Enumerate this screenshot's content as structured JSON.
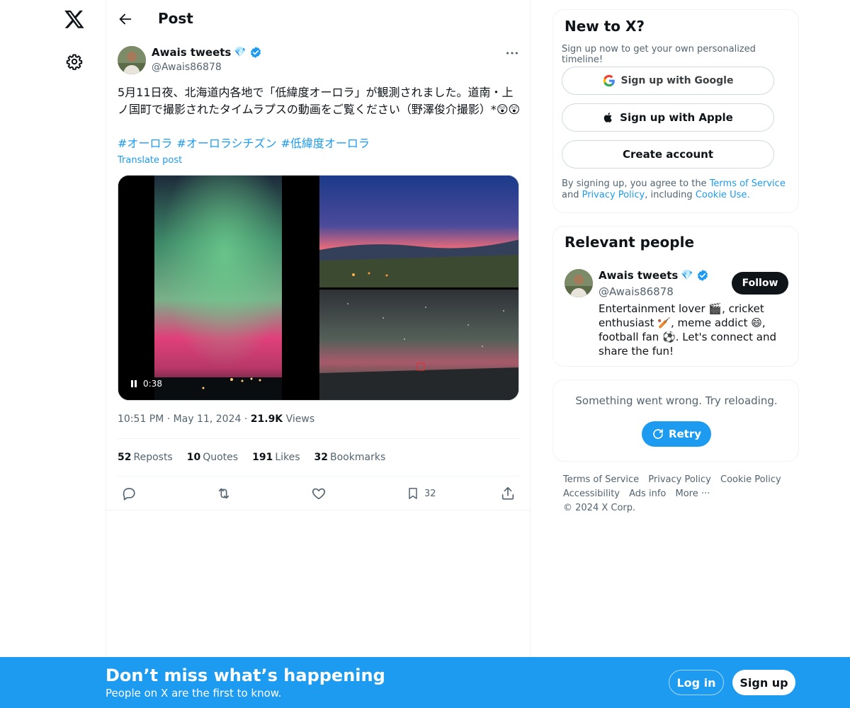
{
  "header": {
    "title": "Post"
  },
  "post": {
    "author_name": "Awais tweets",
    "author_badge": "💎",
    "author_handle": "@Awais86878",
    "text": "5月11日夜、北海道内各地で「低緯度オーロラ」が観測されました。道南・上ノ国町で撮影されたタイムラプスの動画をご覧ください（野澤俊介撮影）*😲😲",
    "hashtags": [
      "#オーロラ",
      "#オーロラシチズン",
      "#低緯度オーロラ"
    ],
    "translate_label": "Translate post",
    "video_time": "0:38",
    "timestamp": "10:51 PM · May 11, 2024 · ",
    "views_count": "21.9K",
    "views_label": " Views",
    "stats": {
      "reposts_count": "52",
      "reposts_label": "Reposts",
      "quotes_count": "10",
      "quotes_label": "Quotes",
      "likes_count": "191",
      "likes_label": "Likes",
      "bookmarks_count": "32",
      "bookmarks_label": "Bookmarks"
    },
    "bookmark_action_count": "32"
  },
  "signup_card": {
    "title": "New to X?",
    "subtitle": "Sign up now to get your own personalized timeline!",
    "google_label": "Sign up with Google",
    "apple_label": "Sign up with Apple",
    "create_label": "Create account",
    "legal_prefix": "By signing up, you agree to the ",
    "terms": "Terms of Service",
    "and": " and ",
    "privacy": "Privacy Policy",
    "including": ", including ",
    "cookie": "Cookie Use."
  },
  "relevant": {
    "title": "Relevant people",
    "name": "Awais tweets",
    "badge": "💎",
    "handle": "@Awais86878",
    "follow_label": "Follow",
    "bio": "Entertainment lover 🎬, cricket enthusiast 🏏, meme addict 😄, football fan ⚽. Let's connect and share the fun!"
  },
  "error_card": {
    "message": "Something went wrong. Try reloading.",
    "retry_label": "Retry"
  },
  "footer": {
    "links": [
      "Terms of Service",
      "Privacy Policy",
      "Cookie Policy",
      "Accessibility",
      "Ads info",
      "More ···",
      "© 2024 X Corp."
    ]
  },
  "banner": {
    "title": "Don’t miss what’s happening",
    "subtitle": "People on X are the first to know.",
    "login_label": "Log in",
    "signup_label": "Sign up"
  },
  "colors": {
    "accent": "#1d9bf0",
    "text": "#0f1419",
    "muted": "#536471"
  }
}
